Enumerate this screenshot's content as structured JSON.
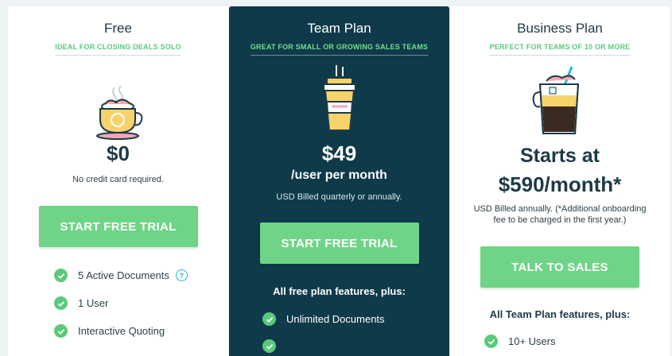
{
  "plans": [
    {
      "name": "Free",
      "tagline": "IDEAL FOR CLOSING DEALS SOLO",
      "price": "$0",
      "note": "No credit card required.",
      "cta": "START FREE TRIAL",
      "features": [
        "5 Active Documents",
        "1 User",
        "Interactive Quoting"
      ],
      "illustration_icon": "coffee-cup-icon"
    },
    {
      "name": "Team Plan",
      "tagline": "GREAT FOR SMALL OR GROWING SALES TEAMS",
      "price": "$49",
      "price_unit": "/user per month",
      "note": "USD Billed quarterly or annually.",
      "cta": "START FREE TRIAL",
      "features_heading": "All free plan features, plus:",
      "features": [
        "Unlimited Documents"
      ],
      "illustration_icon": "takeaway-cup-icon"
    },
    {
      "name": "Business Plan",
      "tagline": "PERFECT FOR TEAMS OF 10 OR MORE",
      "price_line1": "Starts at",
      "price_line2": "$590/month*",
      "note_line1": "USD Billed annually. (*Additional onboarding",
      "note_line2": "fee to be charged in the first year.)",
      "cta": "TALK TO SALES",
      "features_heading": "All Team Plan features, plus:",
      "features": [
        "10+ Users"
      ],
      "illustration_icon": "iced-drink-icon"
    }
  ],
  "colors": {
    "accent_green": "#6fd487",
    "team_background": "#0f3a4a",
    "tagline_green": "#5ac97b",
    "help_blue": "#28b5d8"
  }
}
